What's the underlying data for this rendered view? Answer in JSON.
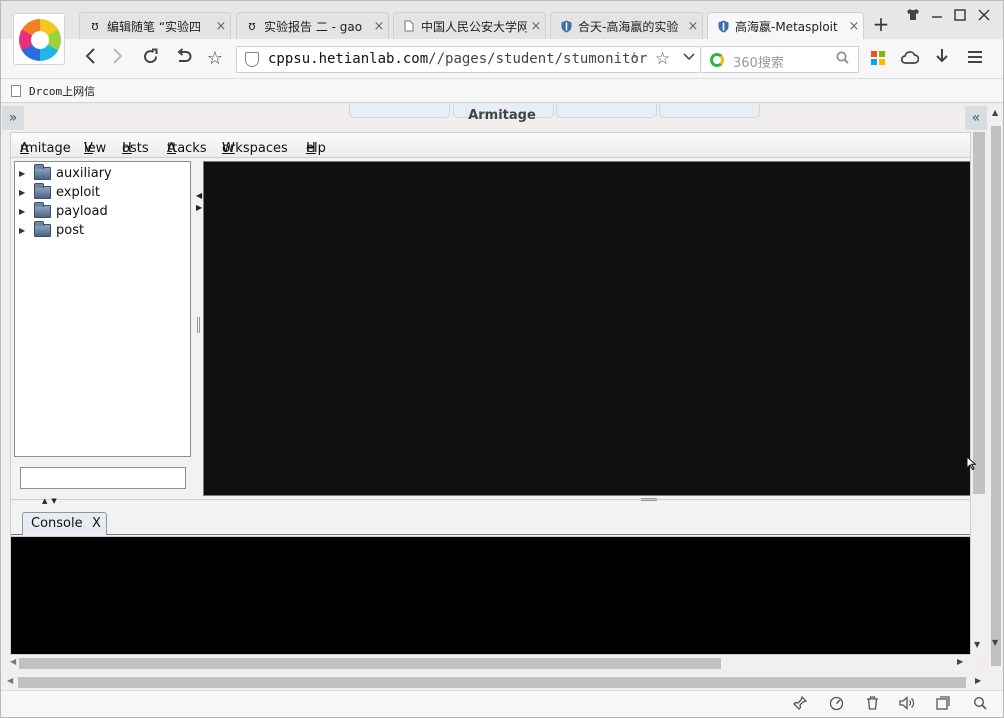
{
  "browser": {
    "tabs": [
      {
        "label": "编辑随笔 “实验四",
        "icon": "feather-icon"
      },
      {
        "label": "实验报告 二 - gao",
        "icon": "feather-icon"
      },
      {
        "label": "中国人民公安大学网",
        "icon": "page-icon"
      },
      {
        "label": "合天-高海嬴的实验",
        "icon": "shield-icon"
      },
      {
        "label": "高海嬴-Metasploit",
        "icon": "shield-icon",
        "active": true
      }
    ],
    "new_tab": "+",
    "close_glyph": "×",
    "url_host": "cppsu.hetianlab.com",
    "url_path": "//pages/student/stumonitor",
    "search_placeholder": "360搜索",
    "bookmark": "Drcom上网信"
  },
  "armitage": {
    "window_title": "Armitage",
    "menu": [
      "Armitage",
      "View",
      "Hosts",
      "Attacks",
      "Workspaces",
      "Help"
    ],
    "modules": [
      "auxiliary",
      "exploit",
      "payload",
      "post"
    ],
    "module_search_value": "",
    "console_tab": {
      "label": "Console",
      "close": "X"
    }
  },
  "colors": {
    "targets_bg": "#101010",
    "console_bg": "#000000",
    "page_bg": "#f3eeee"
  }
}
